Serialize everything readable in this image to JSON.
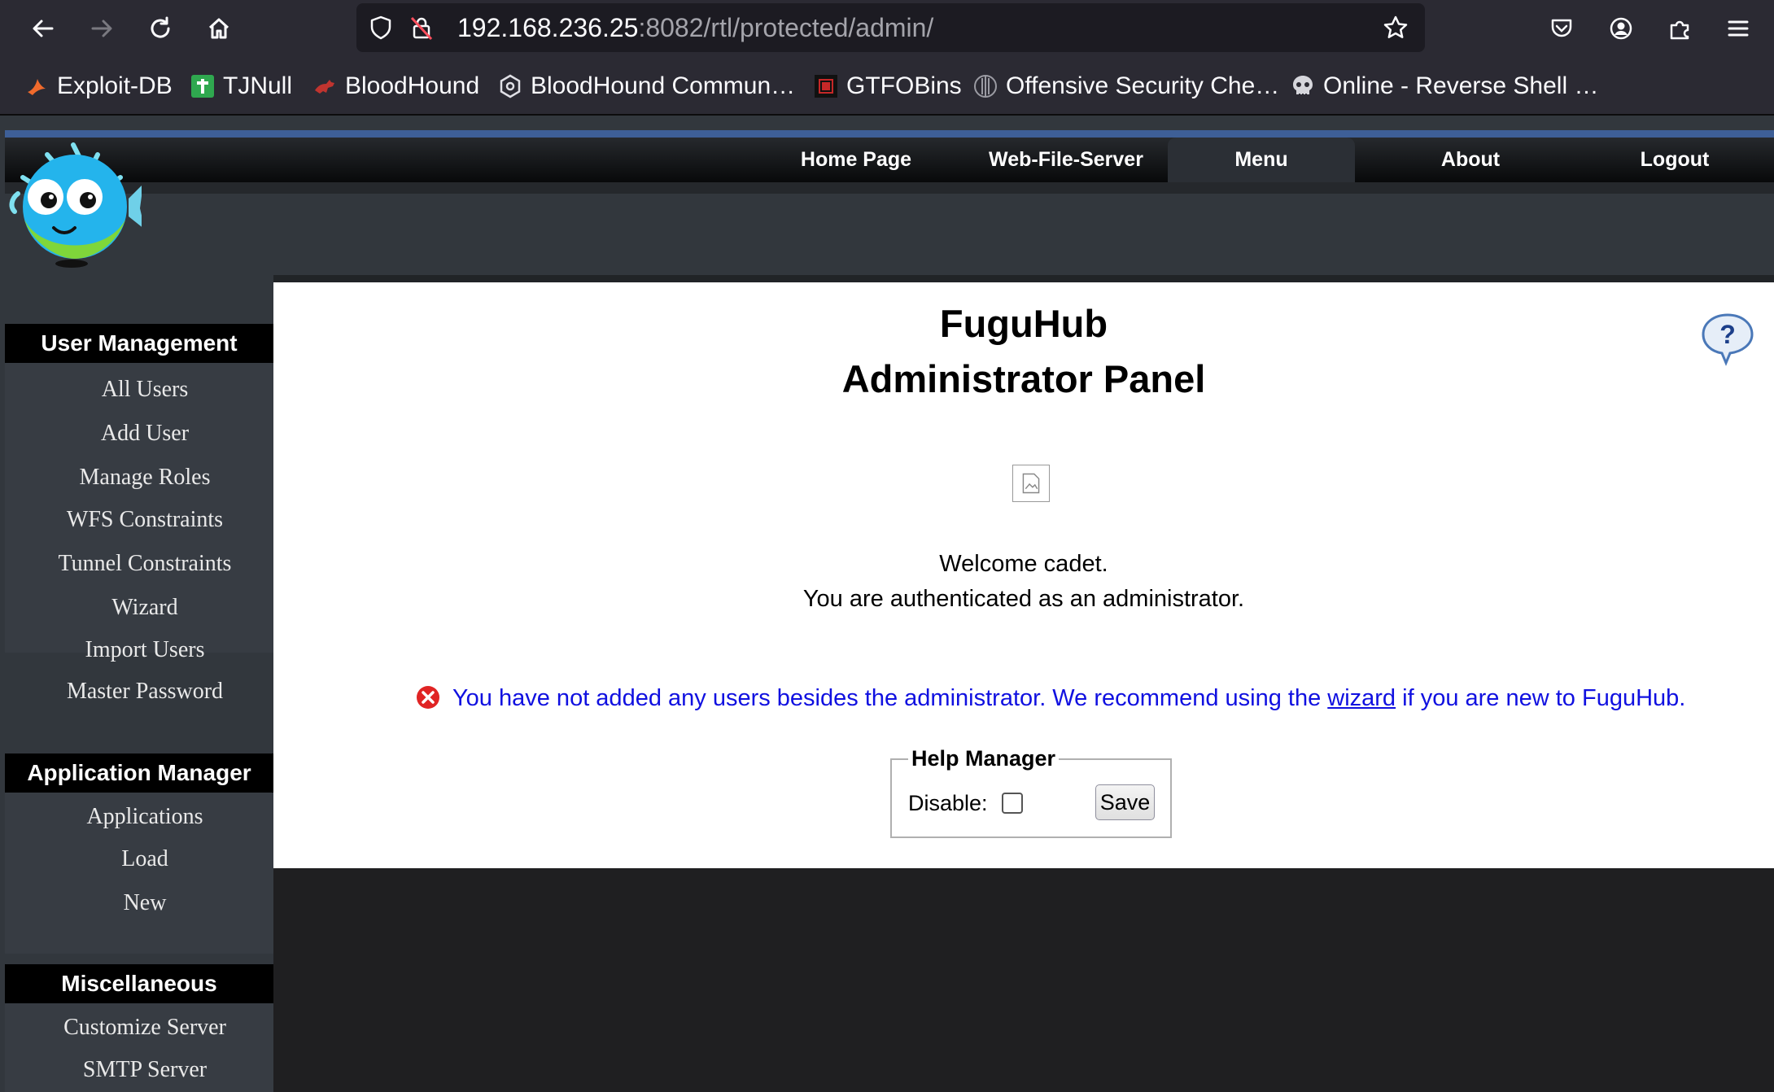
{
  "browser": {
    "url_host": "192.168.236.25",
    "url_path": ":8082/rtl/protected/admin/",
    "nav_icons": [
      "back-arrow-icon",
      "forward-arrow-icon",
      "reload-icon",
      "home-icon"
    ],
    "right_icons": [
      "pocket-icon",
      "account-icon",
      "extensions-icon",
      "hamburger-menu-icon"
    ],
    "bookmarks": [
      {
        "label": "Exploit-DB",
        "icon": "exploit-db-icon"
      },
      {
        "label": "TJNull",
        "icon": "tjnull-icon"
      },
      {
        "label": "BloodHound",
        "icon": "bloodhound-icon"
      },
      {
        "label": "BloodHound Commun…",
        "icon": "bloodhound-community-icon"
      },
      {
        "label": "GTFOBins",
        "icon": "gtfobins-icon"
      },
      {
        "label": "Offensive Security Che…",
        "icon": "offsec-icon"
      },
      {
        "label": "Online - Reverse Shell …",
        "icon": "skull-icon"
      }
    ]
  },
  "nav": {
    "items": [
      {
        "label": "Home Page"
      },
      {
        "label": "Web-File-Server"
      },
      {
        "label": "Menu",
        "active": true
      },
      {
        "label": "About"
      },
      {
        "label": "Logout"
      }
    ]
  },
  "sidebar": {
    "sections": [
      {
        "title": "User Management",
        "items": [
          "All Users",
          "Add User",
          "Manage Roles",
          "WFS Constraints",
          "Tunnel Constraints",
          "Wizard",
          "Import Users",
          "Master Password"
        ]
      },
      {
        "title": "Application Manager",
        "items": [
          "Applications",
          "Load",
          "New"
        ]
      },
      {
        "title": "Miscellaneous",
        "items": [
          "Customize Server",
          "SMTP Server"
        ]
      }
    ]
  },
  "main": {
    "title_line1": "FuguHub",
    "title_line2": "Administrator Panel",
    "welcome": "Welcome cadet.",
    "auth": "You are authenticated as an administrator.",
    "warning": {
      "before": "You have not added any users besides the administrator. We recommend using the ",
      "link": "wizard",
      "after": " if you are new to FuguHub."
    },
    "help_manager": {
      "legend": "Help Manager",
      "disable_label": "Disable:",
      "disabled": false,
      "save_label": "Save"
    }
  },
  "colors": {
    "browser_chrome": "#2b2a33",
    "sidebar_bg": "#32373d",
    "nav_stripe": "#3e5f97",
    "warning_text": "#1010e0",
    "error_icon": "#e02424"
  }
}
